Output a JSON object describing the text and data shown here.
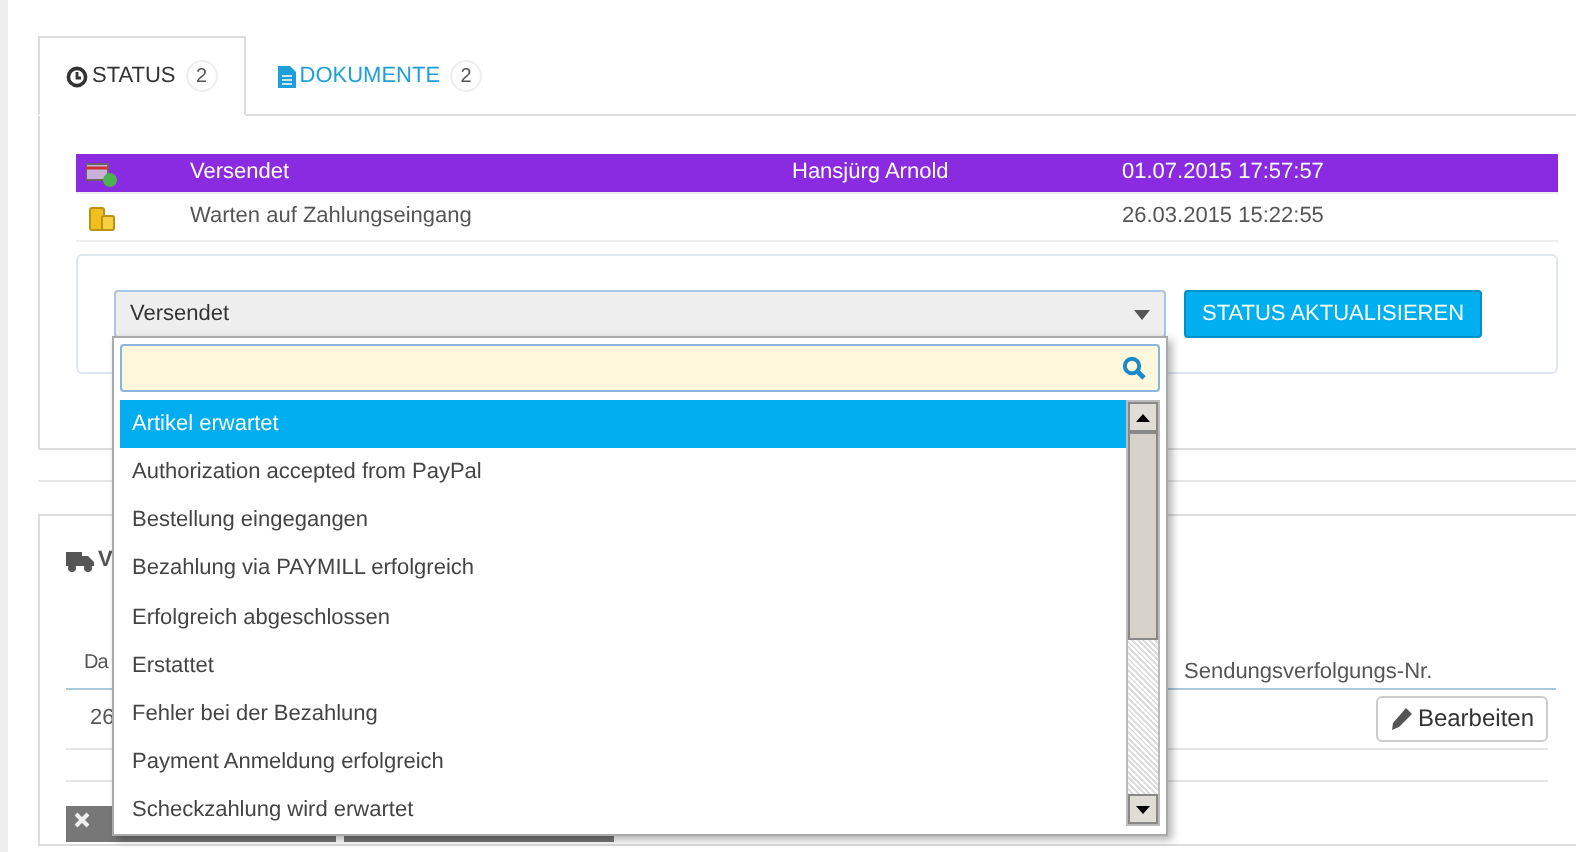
{
  "tabs": [
    {
      "label": "STATUS",
      "count": "2",
      "selected": true
    },
    {
      "label": "DOKUMENTE",
      "count": "2",
      "selected": false
    }
  ],
  "history": [
    {
      "status": "Versendet",
      "employee": "Hansjürg Arnold",
      "date": "01.07.2015 17:57:57",
      "color": "#8a2be2"
    },
    {
      "status": "Warten auf Zahlungseingang",
      "date": "26.03.2015 15:22:55"
    }
  ],
  "status_select": {
    "value": "Versendet",
    "button": "STATUS AKTUALISIEREN"
  },
  "dropdown": {
    "items": [
      {
        "label": "Artikel erwartet",
        "selected": true
      },
      {
        "label": "Authorization accepted from PayPal",
        "selected": false
      },
      {
        "label": "Bestellung eingegangen",
        "selected": false
      },
      {
        "label": "Bezahlung via PAYMILL erfolgreich",
        "selected": false
      },
      {
        "label": "Erfolgreich abgeschlossen",
        "selected": false
      },
      {
        "label": "Erstattet",
        "selected": false
      },
      {
        "label": "Fehler bei der Bezahlung",
        "selected": false
      },
      {
        "label": "Payment Anmeldung erfolgreich",
        "selected": false
      },
      {
        "label": "Scheckzahlung wird erwartet",
        "selected": false
      }
    ]
  },
  "shipping": {
    "title": "V",
    "columns": [
      "Da",
      "Sendungsverfolgungs-Nr."
    ],
    "rows": [
      {
        "column_1": "26",
        "action": "Bearbeiten"
      }
    ]
  }
}
